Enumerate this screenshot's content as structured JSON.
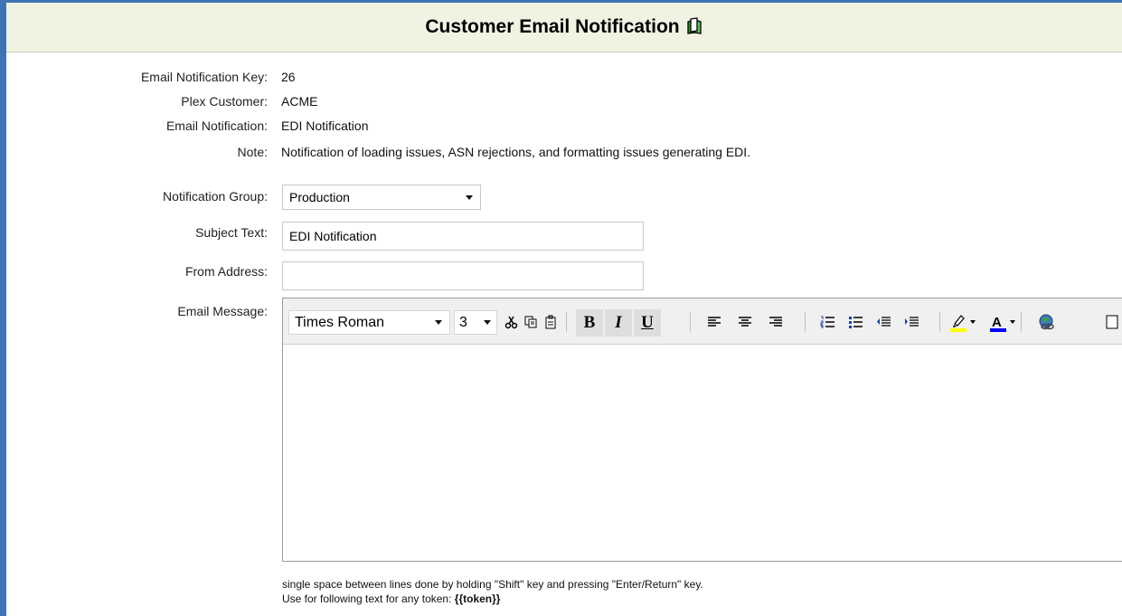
{
  "page": {
    "title": "Customer Email Notification",
    "header_icon": "book-icon"
  },
  "fields": {
    "email_notification_key": {
      "label": "Email Notification Key:",
      "value": "26"
    },
    "plex_customer": {
      "label": "Plex Customer:",
      "value": "ACME"
    },
    "email_notification": {
      "label": "Email Notification:",
      "value": "EDI Notification"
    },
    "note": {
      "label": "Note:",
      "value": "Notification of loading issues, ASN rejections, and formatting issues generating EDI."
    },
    "notification_group": {
      "label": "Notification Group:",
      "selected": "Production"
    },
    "subject_text": {
      "label": "Subject Text:",
      "value": "EDI Notification"
    },
    "from_address": {
      "label": "From Address:",
      "value": ""
    },
    "email_message": {
      "label": "Email Message:"
    }
  },
  "editor": {
    "font_family": "Times Roman",
    "font_size": "3",
    "toolbar_icons": [
      "cut-icon",
      "copy-icon",
      "paste-icon",
      "bold-button",
      "italic-button",
      "underline-button",
      "align-left-icon",
      "align-center-icon",
      "align-right-icon",
      "numbered-list-icon",
      "bullet-list-icon",
      "outdent-icon",
      "indent-icon",
      "highlight-color-icon",
      "font-color-icon",
      "insert-link-icon"
    ],
    "bold_label": "B",
    "italic_label": "I",
    "underline_label": "U",
    "font_color_glyph": "A",
    "highlight_color": "#ffff00",
    "font_color": "#0000ff"
  },
  "help": {
    "line1": "single space between lines done by holding \"Shift\" key and pressing \"Enter/Return\" key.",
    "line2_prefix": "Use for following text for any token:",
    "token": "{{token}}"
  },
  "colors": {
    "frame": "#3f73b6",
    "header_bg": "#f1f2e2",
    "book_icon": "#2e9b2e"
  }
}
